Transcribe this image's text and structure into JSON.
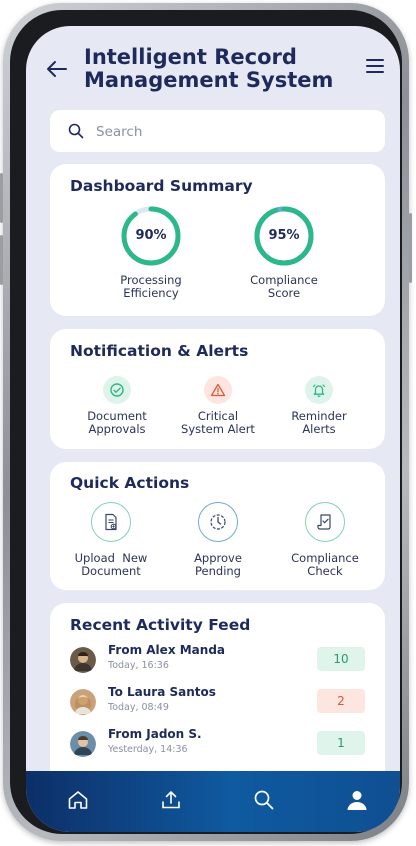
{
  "header": {
    "title_line1": "Intelligent Record",
    "title_line2": "Management System"
  },
  "search": {
    "placeholder": "Search"
  },
  "dashboard": {
    "title": "Dashboard Summary",
    "gauges": [
      {
        "value": "90%",
        "label_line1": "Processing",
        "label_line2": "Efficiency",
        "fraction": 0.9,
        "color": "#2db88a"
      },
      {
        "value": "95%",
        "label_line1": "Compliance",
        "label_line2": "Score",
        "fraction": 0.95,
        "color": "#2db88a"
      }
    ]
  },
  "notifications": {
    "title": "Notification & Alerts",
    "items": [
      {
        "icon": "check-circle-icon",
        "line1": "Document",
        "line2": "Approvals"
      },
      {
        "icon": "warning-icon",
        "line1": "Critical",
        "line2": "System Alert"
      },
      {
        "icon": "bell-icon",
        "line1": "Reminder",
        "line2": "Alerts"
      }
    ]
  },
  "quick_actions": {
    "title": "Quick Actions",
    "items": [
      {
        "icon": "upload-document-icon",
        "line1": "Upload  New",
        "line2": "Document"
      },
      {
        "icon": "clock-icon",
        "line1": "Approve",
        "line2": "Pending"
      },
      {
        "icon": "scroll-check-icon",
        "line1": "Compliance",
        "line2": "Check"
      }
    ]
  },
  "activity": {
    "title": "Recent Activity Feed",
    "rows": [
      {
        "name": "From Alex Manda",
        "time": "Today, 16:36",
        "count": "10",
        "badge_color": "#dff5ec",
        "text_color": "#2a9a6e"
      },
      {
        "name": "To Laura Santos",
        "time": "Today, 08:49",
        "count": "2",
        "badge_color": "#fde6e0",
        "text_color": "#d8563c"
      },
      {
        "name": "From Jadon S.",
        "time": "Yesterday, 14:36",
        "count": "1",
        "badge_color": "#dff5ec",
        "text_color": "#2a9a6e"
      }
    ]
  },
  "nav": {
    "icons": [
      "home-icon",
      "upload-icon",
      "search-icon",
      "profile-icon"
    ]
  },
  "colors": {
    "accent": "#1f2a5c",
    "nav": "#0f4f92",
    "green": "#2db88a",
    "red": "#e0593f"
  }
}
